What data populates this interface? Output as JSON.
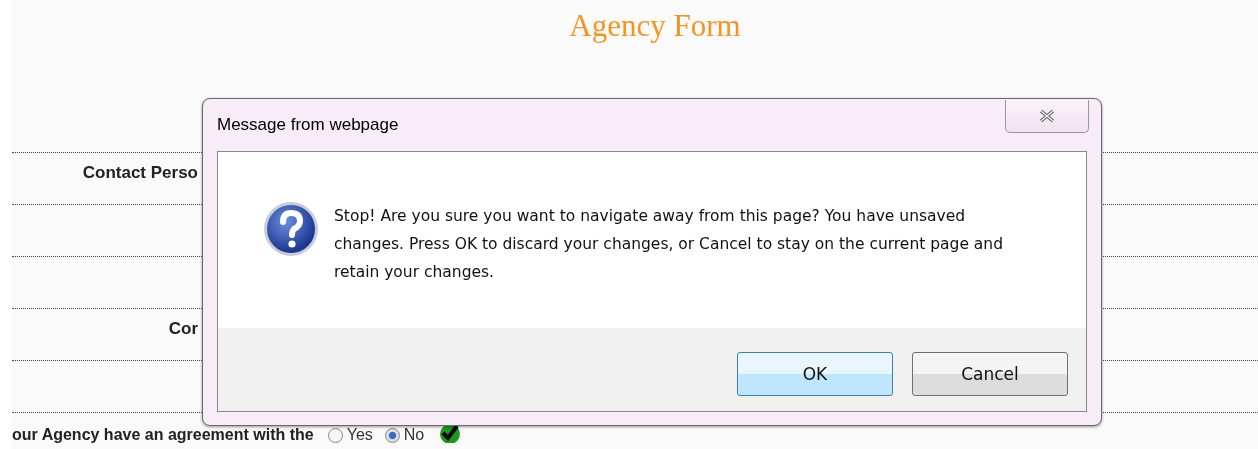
{
  "page": {
    "title": "Agency Form"
  },
  "form_rows": [
    {
      "label": "Contact Perso"
    },
    {},
    {},
    {
      "label": "Cor"
    },
    {}
  ],
  "agreement": {
    "question": "our Agency have an agreement with the",
    "options": [
      {
        "label": "Yes",
        "selected": false
      },
      {
        "label": "No",
        "selected": true
      }
    ],
    "valid": true
  },
  "dialog": {
    "title": "Message from webpage",
    "message": "Stop! Are you sure you want to navigate away from this page? You have unsaved changes. Press OK to discard your changes, or Cancel to stay on the current page and retain your changes.",
    "buttons": [
      "OK",
      "Cancel"
    ]
  }
}
